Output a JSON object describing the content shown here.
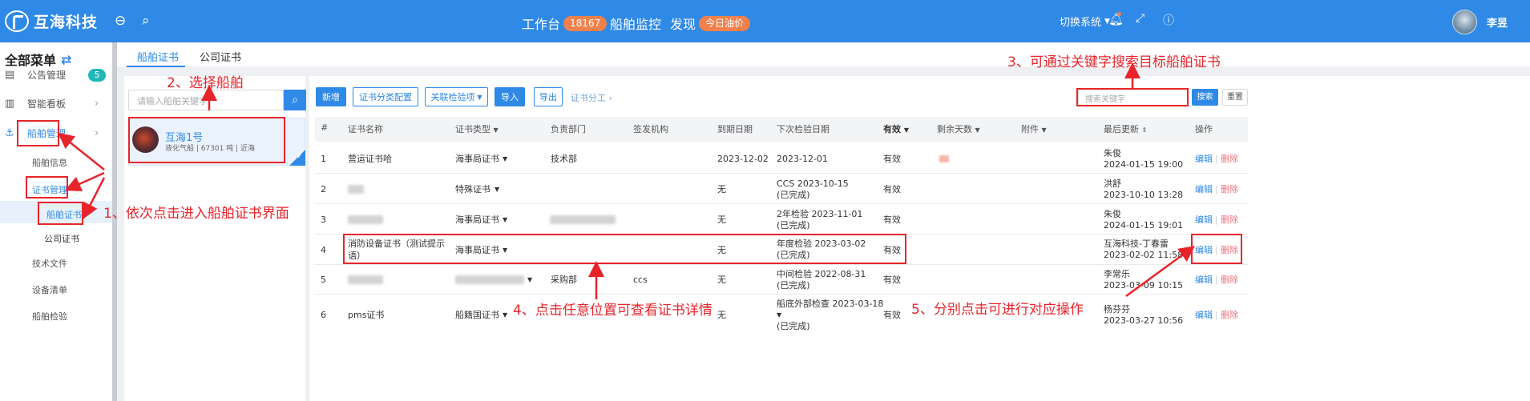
{
  "topbar": {
    "logo_text": "互海科技",
    "nav": [
      {
        "label": "工作台",
        "badge": "18167"
      },
      {
        "label": "船舶监控",
        "badge": ""
      },
      {
        "label": "发现",
        "badge": "今日油价"
      }
    ],
    "switch_system": "切换系统",
    "user_name": "李昱"
  },
  "sidebar": {
    "title": "全部菜单",
    "items": [
      {
        "label": "公告管理",
        "badge": "5"
      },
      {
        "label": "智能看板"
      },
      {
        "label": "船舶管理"
      }
    ],
    "sub_items": [
      "船舶信息",
      "证书管理",
      "船舶证书",
      "公司证书",
      "技术文件",
      "设备清单",
      "船舶检验"
    ]
  },
  "tabs": [
    "船舶证书",
    "公司证书"
  ],
  "ship_panel": {
    "search_placeholder": "请输入船舶关键字",
    "ship_name": "互海1号",
    "ship_info": "液化气船 | 67301 吨 | 近海"
  },
  "toolbar": {
    "add": "新增",
    "category_config": "证书分类配置",
    "related_inspection": "关联检验项",
    "import": "导入",
    "export": "导出",
    "assign": "证书分工",
    "keyword_placeholder": "搜索关键字",
    "search": "搜索",
    "reset": "重置"
  },
  "table": {
    "headers": [
      "#",
      "证书名称",
      "证书类型",
      "负责部门",
      "签发机构",
      "到期日期",
      "下次检验日期",
      "有效",
      "剩余天数",
      "附件",
      "最后更新",
      "操作"
    ],
    "rows": [
      {
        "no": "1",
        "name": "营运证书哈",
        "type": "海事局证书",
        "dept": "技术部",
        "issuer": "",
        "expiry": "2023-12-02",
        "next": "2023-12-01",
        "next_sub": "",
        "valid": "有效",
        "updater": "朱俊",
        "updated": "2024-01-15 19:00"
      },
      {
        "no": "2",
        "name": "",
        "type": "特殊证书",
        "dept": "",
        "issuer": "",
        "expiry": "无",
        "next": "CCS 2023-10-15",
        "next_sub": "(已完成)",
        "valid": "有效",
        "updater": "洪舒",
        "updated": "2023-10-10 13:28"
      },
      {
        "no": "3",
        "name": "",
        "type": "海事局证书",
        "dept": "",
        "issuer": "",
        "expiry": "无",
        "next": "2年检验 2023-11-01",
        "next_sub": "(已完成)",
        "valid": "有效",
        "updater": "朱俊",
        "updated": "2024-01-15 19:01"
      },
      {
        "no": "4",
        "name": "消防设备证书（测试提示语）",
        "type": "海事局证书",
        "dept": "",
        "issuer": "",
        "expiry": "无",
        "next": "年度检验 2023-03-02",
        "next_sub": "(已完成)",
        "valid": "有效",
        "updater": "互海科技-丁春雷",
        "updated": "2023-02-02 11:58"
      },
      {
        "no": "5",
        "name": "",
        "type": "",
        "dept": "采购部",
        "issuer": "ccs",
        "expiry": "无",
        "next": "中间检验 2022-08-31",
        "next_sub": "(已完成)",
        "valid": "有效",
        "updater": "李常乐",
        "updated": "2023-03-09 10:15"
      },
      {
        "no": "6",
        "name": "pms证书",
        "type": "船籍国证书",
        "dept": "",
        "issuer": "",
        "expiry": "无",
        "next": "船底外部检查 2023-03-18",
        "next_sub": "(已完成)",
        "valid": "有效",
        "updater": "杨芬芬",
        "updated": "2023-03-27 10:56"
      }
    ],
    "action_edit": "编辑",
    "action_delete": "删除"
  },
  "annotations": {
    "a1": "1、依次点击进入船舶证书界面",
    "a2": "2、选择船舶",
    "a3": "3、可通过关键字搜索目标船舶证书",
    "a4": "4、点击任意位置可查看证书详情",
    "a5": "5、分别点击可进行对应操作"
  },
  "colors": {
    "primary": "#2f89e6",
    "annotation": "#e8242b",
    "delete": "#f0707a",
    "badge": "#f0814c"
  }
}
